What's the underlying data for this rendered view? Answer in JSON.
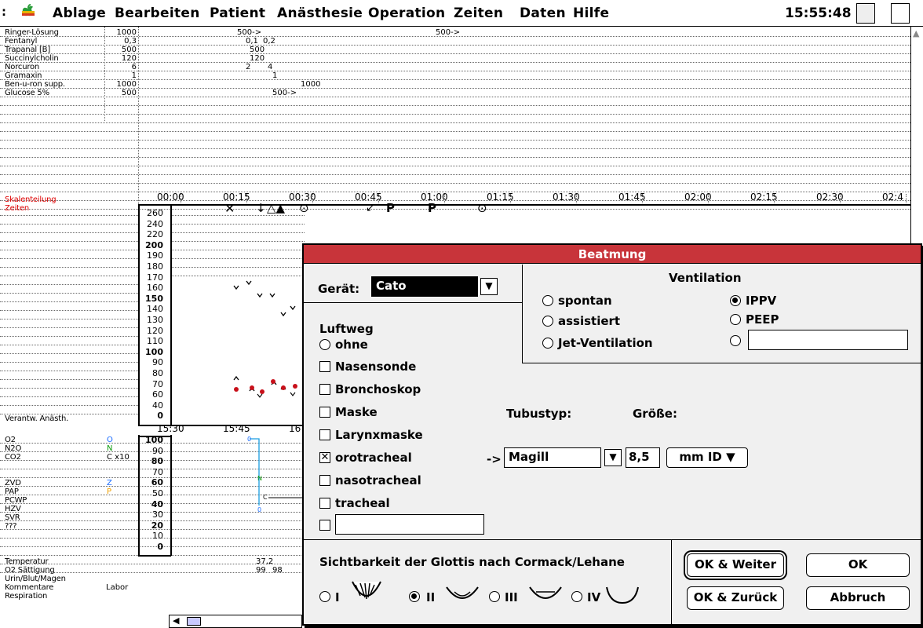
{
  "menubar": {
    "menus": [
      "Ablage",
      "Bearbeiten",
      "Patient",
      "Anästhesie",
      "Operation",
      "Zeiten",
      "Daten",
      "Hilfe"
    ],
    "clock": "15:55:48"
  },
  "medications": [
    {
      "name": "Ringer-Lösung",
      "dose": "1000"
    },
    {
      "name": "Fentanyl",
      "dose": "0,3"
    },
    {
      "name": "Trapanal [B]",
      "dose": "500"
    },
    {
      "name": "Succinylcholin",
      "dose": "120"
    },
    {
      "name": "Norcuron",
      "dose": "6"
    },
    {
      "name": "Gramaxin",
      "dose": "1"
    },
    {
      "name": "Ben-u-ron supp.",
      "dose": "1000"
    },
    {
      "name": "Glucose 5%",
      "dose": "500"
    }
  ],
  "med_entries": [
    "500->",
    "500->",
    "0,1",
    "0,2",
    "500",
    "120",
    "2",
    "4",
    "1",
    "1000",
    "500->"
  ],
  "skalen_label": "Skalenteilung",
  "zeiten_label": "Zeiten",
  "time_ticks": [
    "00:00",
    "00:15",
    "00:30",
    "00:45",
    "01:00",
    "01:15",
    "01:30",
    "01:45",
    "02:00",
    "02:15",
    "02:30",
    "02:4"
  ],
  "vitals_scale": [
    "260",
    "240",
    "220",
    "200",
    "190",
    "180",
    "170",
    "160",
    "150",
    "140",
    "130",
    "120",
    "110",
    "100",
    "90",
    "80",
    "70",
    "60",
    "40",
    "0"
  ],
  "verantw_label": "Verantw. Anästh.",
  "lower_ticks": [
    "15:30",
    "15:45",
    "16"
  ],
  "lower_labels": [
    {
      "name": "O2",
      "key": "O",
      "color": "#1a6cff"
    },
    {
      "name": "N2O",
      "key": "N",
      "color": "#0a9a0a"
    },
    {
      "name": "CO2",
      "key": "C x10",
      "color": "#000"
    },
    {
      "name": "",
      "key": "",
      "color": "#000"
    },
    {
      "name": "",
      "key": "",
      "color": "#000"
    },
    {
      "name": "ZVD",
      "key": "Z",
      "color": "#1a6cff"
    },
    {
      "name": "PAP",
      "key": "P",
      "color": "#f0a000"
    },
    {
      "name": "PCWP",
      "key": "",
      "color": "#000"
    },
    {
      "name": "HZV",
      "key": "",
      "color": "#000"
    },
    {
      "name": "SVR",
      "key": "",
      "color": "#000"
    },
    {
      "name": "???",
      "key": "",
      "color": "#000"
    }
  ],
  "lower_scale": [
    "100",
    "90",
    "80",
    "70",
    "60",
    "50",
    "40",
    "30",
    "20",
    "10",
    "0"
  ],
  "bottom_labels": [
    "Temperatur",
    "O2 Sättigung",
    "Urin/Blut/Magen",
    "Kommentare",
    "Respiration"
  ],
  "kommentare_value": "Labor",
  "temperatur_value": "37,2",
  "saettigung_values": [
    "99",
    "98"
  ],
  "dialog": {
    "title": "Beatmung",
    "geraet_label": "Gerät:",
    "geraet_value": "Cato",
    "ventilation_label": "Ventilation",
    "ventilation_left": [
      {
        "label": "spontan",
        "checked": false
      },
      {
        "label": "assistiert",
        "checked": false
      },
      {
        "label": "Jet-Ventilation",
        "checked": false
      }
    ],
    "ventilation_right": [
      {
        "label": "IPPV",
        "checked": true
      },
      {
        "label": "PEEP",
        "checked": false
      }
    ],
    "luftweg_label": "Luftweg",
    "luftweg_radio": {
      "label": "ohne",
      "checked": false
    },
    "luftweg_items": [
      {
        "label": "Nasensonde",
        "checked": false
      },
      {
        "label": "Bronchoskop",
        "checked": false
      },
      {
        "label": "Maske",
        "checked": false
      },
      {
        "label": "Larynxmaske",
        "checked": false
      },
      {
        "label": "orotracheal",
        "checked": true
      },
      {
        "label": "nasotracheal",
        "checked": false
      },
      {
        "label": "tracheal",
        "checked": false
      }
    ],
    "tubustyp_label": "Tubustyp:",
    "groesse_label": "Größe:",
    "arrow": "->",
    "tubustyp_value": "Magill",
    "groesse_value": "8,5",
    "unit_value": "mm ID",
    "glottis_label": "Sichtbarkeit der Glottis nach Cormack/Lehane",
    "glottis_options": [
      {
        "label": "I",
        "checked": false
      },
      {
        "label": "II",
        "checked": true
      },
      {
        "label": "III",
        "checked": false
      },
      {
        "label": "IV",
        "checked": false
      }
    ],
    "buttons": {
      "ok_weiter": "OK & Weiter",
      "ok": "OK",
      "ok_zurueck": "OK & Zurück",
      "abbruch": "Abbruch"
    }
  }
}
